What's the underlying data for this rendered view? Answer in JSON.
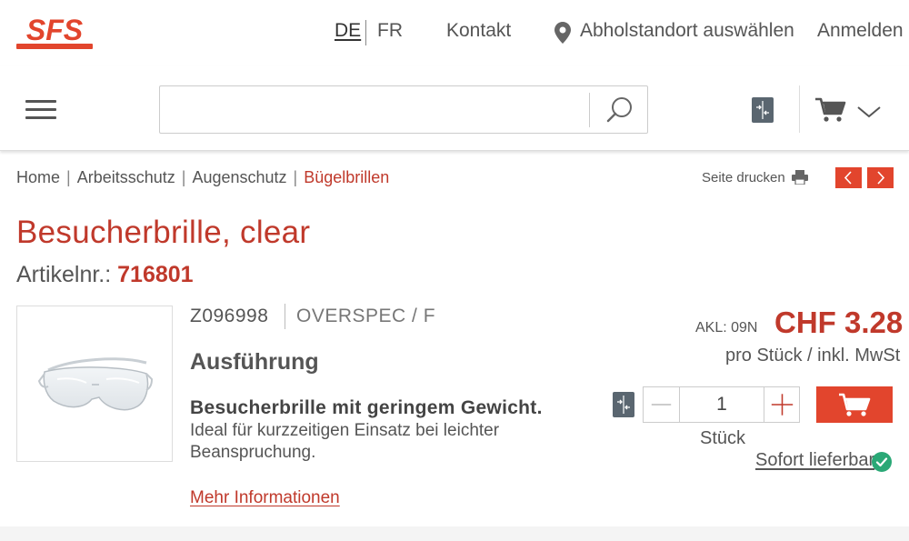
{
  "brand": {
    "logo_text": "SFS",
    "accent": "#e2452d",
    "text_red": "#c0392b"
  },
  "header": {
    "lang_active": "DE",
    "lang_other": "FR",
    "contact": "Kontakt",
    "pickup": "Abholstandort auswählen",
    "login": "Anmelden"
  },
  "search": {
    "placeholder": "",
    "value": ""
  },
  "icons": {
    "menu": "hamburger-icon",
    "search": "search-icon",
    "compare": "compare-icon",
    "cart": "cart-icon",
    "chevron": "chevron-down-icon",
    "pin": "location-pin-icon",
    "print": "printer-icon",
    "check": "check-circle-icon"
  },
  "breadcrumb": {
    "items": [
      "Home",
      "Arbeitsschutz",
      "Augenschutz",
      "Bügelbrillen"
    ],
    "separator": "|"
  },
  "page_tools": {
    "print_label": "Seite drucken"
  },
  "product": {
    "title": "Besucherbrille, clear",
    "article_label": "Artikelnr.:",
    "article_number": "716801",
    "code": "Z096998",
    "supplier": "OVERSPEC / F",
    "variant_heading": "Ausführung",
    "description_bold": "Besucherbrille mit geringem Gewicht.",
    "description": "Ideal für kurzzeitigen Einsatz bei leichter Beanspruchung.",
    "more_info": "Mehr Informationen"
  },
  "pricing": {
    "akl": "AKL: 09N",
    "price": "CHF 3.28",
    "unit_info": "pro Stück / inkl. MwSt",
    "quantity": "1",
    "unit": "Stück",
    "availability": "Sofort lieferbar",
    "availability_color": "#2aa876"
  }
}
